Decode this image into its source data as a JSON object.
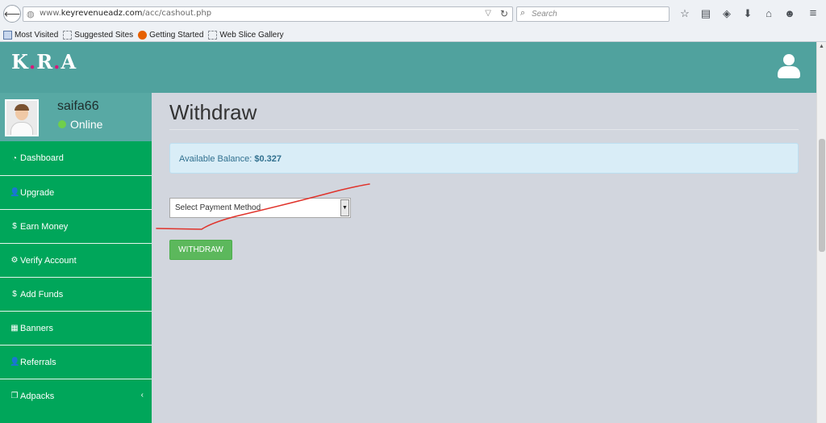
{
  "browser": {
    "url_prefix": "www.",
    "url_domain": "keyrevenueadz.com",
    "url_path": "/acc/cashout.php",
    "search_placeholder": "Search",
    "back_glyph": "⟵",
    "bookmarks": [
      "Most Visited",
      "Suggested Sites",
      "Getting Started",
      "Web Slice Gallery"
    ]
  },
  "header": {
    "logo_parts": [
      "K",
      ".",
      "R",
      ".",
      "A"
    ]
  },
  "user": {
    "name": "saifa66",
    "status": "Online"
  },
  "sidebar": {
    "items": [
      {
        "label": "Dashboard",
        "icon": "dashboard-icon",
        "glyph": "◔"
      },
      {
        "label": "Upgrade",
        "icon": "user-icon",
        "glyph": "👤"
      },
      {
        "label": "Earn Money",
        "icon": "dollar-icon",
        "glyph": "$"
      },
      {
        "label": "Verify Account",
        "icon": "gear-icon",
        "glyph": "⚙"
      },
      {
        "label": "Add Funds",
        "icon": "dollar-icon",
        "glyph": "$"
      },
      {
        "label": "Banners",
        "icon": "table-icon",
        "glyph": "▦"
      },
      {
        "label": "Referrals",
        "icon": "user-icon",
        "glyph": "👤"
      },
      {
        "label": "Adpacks",
        "icon": "copy-icon",
        "glyph": "❐"
      }
    ]
  },
  "main": {
    "title": "Withdraw",
    "balance_label": "Available Balance:",
    "balance_value": "$0.327",
    "select_value": "Select Payment Method",
    "withdraw_button": "WITHDRAW"
  },
  "colors": {
    "header": "#50a29e",
    "sidebar": "#00a65a",
    "button": "#5cb85c",
    "callout": "#d9edf7",
    "annotation": "#e0332b"
  }
}
